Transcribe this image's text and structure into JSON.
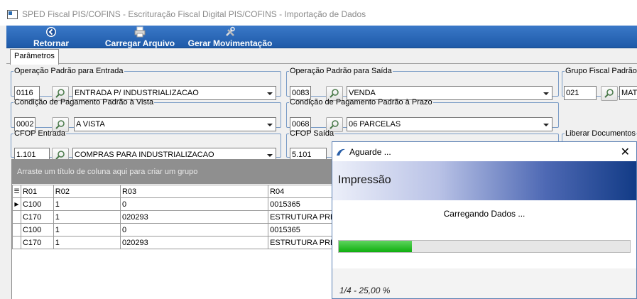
{
  "window": {
    "title": "SPED Fiscal PIS/COFINS - Escrituração Fiscal Digital PIS/COFINS - Importação de Dados"
  },
  "toolbar": {
    "retornar": "Retornar",
    "carregar": "Carregar Arquivo",
    "gerar": "Gerar Movimentação"
  },
  "tabs": {
    "parametros": "Parâmetros"
  },
  "groups": {
    "op_entrada": {
      "legend": "Operação Padrão para Entrada",
      "code": "0116",
      "value": "ENTRADA P/ INDUSTRIALIZACAO"
    },
    "op_saida": {
      "legend": "Operação Padrão para Saída",
      "code": "0083",
      "value": "VENDA"
    },
    "grupo_fiscal": {
      "legend": "Grupo Fiscal Padrão",
      "code": "021",
      "value": "MAT"
    },
    "cond_vista": {
      "legend": "Condição de Pagamento Padrão à Vista",
      "code": "0002",
      "value": "A VISTA"
    },
    "cond_prazo": {
      "legend": "Condição de Pagamento Padrão à Prazo",
      "code": "0068",
      "value": "06 PARCELAS"
    },
    "cfop_entrada": {
      "legend": "CFOP Entrada",
      "code": "1.101",
      "value": "COMPRAS PARA INDUSTRIALIZACAO"
    },
    "cfop_saida": {
      "legend": "CFOP Saída",
      "code": "5.101"
    },
    "liberar": {
      "legend": "Liberar Documentos"
    }
  },
  "grid": {
    "group_hint": "Arraste um título de coluna aqui para criar um grupo",
    "columns": [
      "R01",
      "R02",
      "R03",
      "R04"
    ],
    "rows": [
      [
        "C100",
        "1",
        "0",
        "0015365"
      ],
      [
        "C170",
        "1",
        "020293",
        "ESTRUTURA PRE"
      ],
      [
        "C100",
        "1",
        "0",
        "0015365"
      ],
      [
        "C170",
        "1",
        "020293",
        "ESTRUTURA PRE"
      ]
    ]
  },
  "dialog": {
    "title": "Aguarde ...",
    "banner": "Impressão",
    "message": "Carregando Dados ...",
    "progress": 0.25,
    "status": "1/4 - 25,00 %"
  },
  "colors": {
    "toolbar": "#2a67b8",
    "progress": "#22bb22",
    "groupborder": "#7a9cc6"
  }
}
